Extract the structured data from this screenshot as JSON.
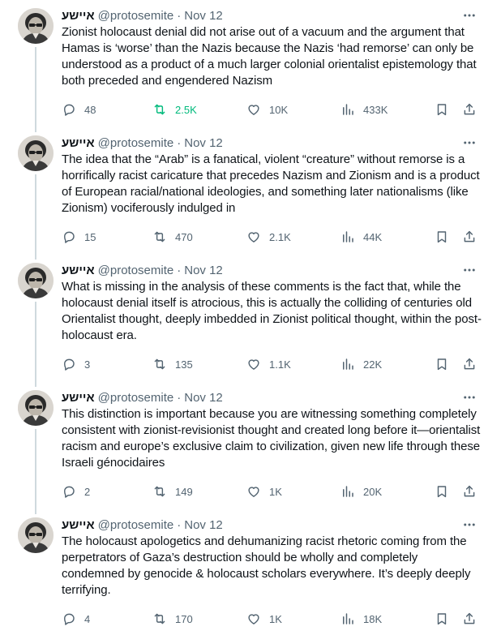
{
  "author": {
    "display_name": "איישע",
    "handle": "@protosemite",
    "separator": "·"
  },
  "colors": {
    "text_primary": "#0f1419",
    "text_secondary": "#536471",
    "retweet_active": "#00ba7c",
    "thread_line": "#cfd9de"
  },
  "icons": [
    "more-icon",
    "reply-icon",
    "retweet-icon",
    "like-icon",
    "views-icon",
    "bookmark-icon",
    "share-icon"
  ],
  "tweets": [
    {
      "date": "Nov 12",
      "text": "Zionist holocaust denial did not arise out of a vacuum and the argument that Hamas is ‘worse’ than the Nazis because the Nazis ‘had remorse’ can only be understood as a product of a much larger colonial orientalist epistemology that both preceded and engendered Nazism",
      "replies": "48",
      "retweets": "2.5K",
      "retweeted": true,
      "likes": "10K",
      "views": "433K"
    },
    {
      "date": "Nov 12",
      "text": "The idea that the “Arab” is a fanatical, violent “creature” without remorse is a horrifically racist caricature that precedes Nazism and Zionism and is a product of European racial/national ideologies, and something later nationalisms (like Zionism) vociferously indulged in",
      "replies": "15",
      "retweets": "470",
      "retweeted": false,
      "likes": "2.1K",
      "views": "44K"
    },
    {
      "date": "Nov 12",
      "text": "What is missing in the analysis of these comments is the fact that, while the holocaust denial itself is atrocious, this is actually the colliding of centuries old Orientalist thought, deeply imbedded in Zionist political thought, within the post-holocaust era.",
      "replies": "3",
      "retweets": "135",
      "retweeted": false,
      "likes": "1.1K",
      "views": "22K"
    },
    {
      "date": "Nov 12",
      "text": "This distinction is important because you are witnessing something completely consistent with zionist-revisionist thought and created long before it—orientalist racism and europe’s exclusive claim to civilization, given new life through these Israeli génocidaires",
      "replies": "2",
      "retweets": "149",
      "retweeted": false,
      "likes": "1K",
      "views": "20K"
    },
    {
      "date": "Nov 12",
      "text": "The holocaust apologetics and dehumanizing racist rhetoric coming from the perpetrators of Gaza’s destruction should be wholly and completely condemned by genocide & holocaust scholars everywhere. It’s deeply deeply terrifying.",
      "replies": "4",
      "retweets": "170",
      "retweeted": false,
      "likes": "1K",
      "views": "18K"
    }
  ]
}
